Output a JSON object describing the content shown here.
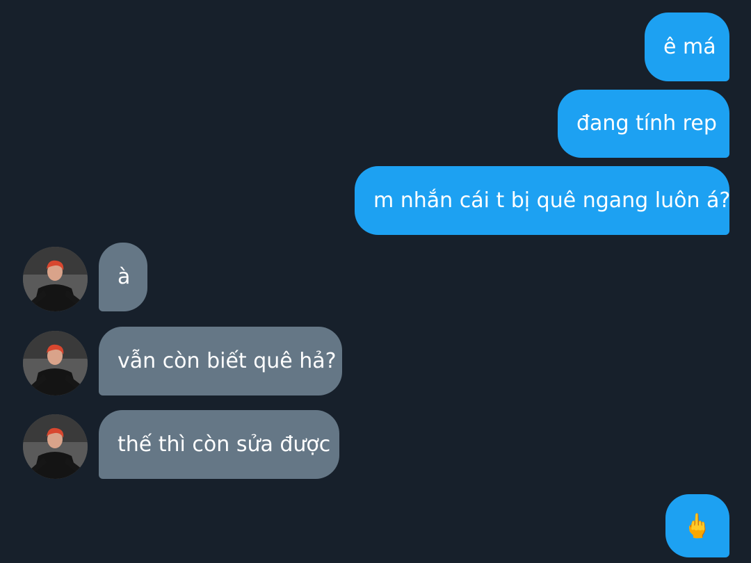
{
  "messages": {
    "m1": "ê má",
    "m2": "đang tính rep",
    "m3": "m nhắn cái t bị quê ngang luôn á?",
    "m4": "à",
    "m5": "vẫn còn biết quê hả?",
    "m6": "thế thì còn sửa được",
    "m7": "🖕"
  },
  "colors": {
    "background": "#17202b",
    "sent_bubble": "#1da1f2",
    "received_bubble": "#657786"
  },
  "icons": {
    "avatar": "contact-avatar-photo"
  }
}
